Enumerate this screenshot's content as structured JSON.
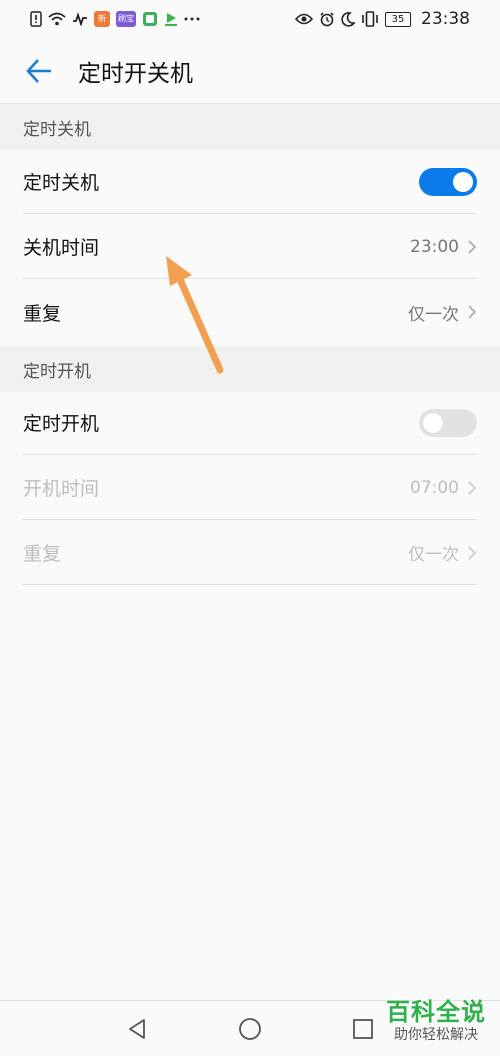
{
  "status_bar": {
    "time": "23:38",
    "battery": "35",
    "app_badges": [
      "新",
      "刷宝"
    ],
    "left_icons": [
      "notification-icon",
      "wifi-icon",
      "activity-icon",
      "app-icon",
      "app-icon",
      "app-icon",
      "video-app-icon",
      "more-icon"
    ],
    "right_icons": [
      "eye-icon",
      "alarm-icon",
      "moon-icon",
      "vibrate-icon",
      "battery-icon"
    ]
  },
  "app_bar": {
    "title": "定时开关机",
    "back_icon": "arrow-left-icon",
    "accent": "#1a7fd4"
  },
  "shutdown_section": {
    "header": "定时关机",
    "toggle_label": "定时关机",
    "toggle_on": true,
    "time_label": "关机时间",
    "time_value": "23:00",
    "repeat_label": "重复",
    "repeat_value": "仅一次"
  },
  "startup_section": {
    "header": "定时开机",
    "toggle_label": "定时开机",
    "toggle_on": false,
    "time_label": "开机时间",
    "time_value": "07:00",
    "repeat_label": "重复",
    "repeat_value": "仅一次"
  },
  "colors": {
    "toggle_on": "#0a7be9",
    "toggle_off": "#e2e2e2",
    "annotation_arrow": "#f0a050"
  },
  "nav_bar": {
    "icons": [
      "back-triangle-icon",
      "home-circle-icon",
      "recents-square-icon"
    ]
  },
  "watermark": {
    "title": "百科全说",
    "subtitle": "助你轻松解决"
  }
}
